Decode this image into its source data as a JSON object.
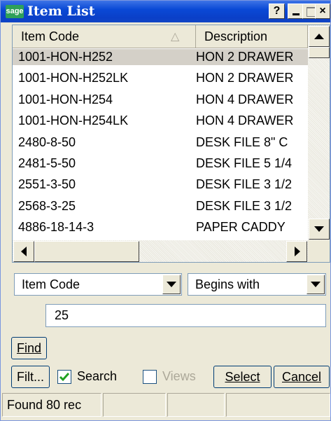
{
  "window": {
    "logo_text": "sage",
    "title": "Item List",
    "help_button": "?",
    "minimize_button": "_",
    "close_button": "×"
  },
  "grid": {
    "columns": [
      "Item Code",
      "Description"
    ],
    "sort_indicator": "△",
    "rows": [
      {
        "code": "1001-HON-H252",
        "description": "HON 2 DRAWER",
        "selected": true
      },
      {
        "code": "1001-HON-H252LK",
        "description": "HON 2 DRAWER"
      },
      {
        "code": "1001-HON-H254",
        "description": "HON 4 DRAWER"
      },
      {
        "code": "1001-HON-H254LK",
        "description": "HON 4 DRAWER"
      },
      {
        "code": "2480-8-50",
        "description": "DESK FILE 8\" C"
      },
      {
        "code": "2481-5-50",
        "description": "DESK FILE 5 1/4"
      },
      {
        "code": "2551-3-50",
        "description": "DESK FILE 3 1/2"
      },
      {
        "code": "2568-3-25",
        "description": "DESK FILE 3 1/2"
      },
      {
        "code": "4886-18-14-3",
        "description": "PAPER CADDY"
      }
    ]
  },
  "filter": {
    "field_value": "Item Code",
    "operator_value": "Begins with",
    "search_value": "25"
  },
  "buttons": {
    "find": "Find",
    "filter": "Filt...",
    "select": "Select",
    "cancel": "Cancel"
  },
  "checkboxes": {
    "search_label": "Search",
    "search_checked": true,
    "views_label": "Views",
    "views_checked": false
  },
  "status": {
    "text": "Found 80 rec"
  }
}
